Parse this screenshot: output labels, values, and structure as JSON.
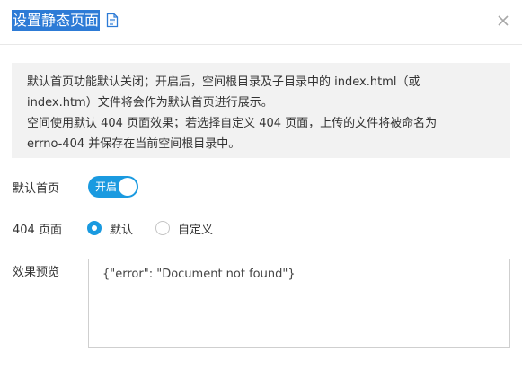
{
  "dialog": {
    "title": "设置静态页面",
    "doc_icon": "document-icon",
    "close_icon": "close-icon",
    "accent_color": "#1a9ae0",
    "title_highlight_color": "#2d7bd6"
  },
  "notice": {
    "lines": [
      "默认首页功能默认关闭；开启后，空间根目录及子目录中的 index.html（或",
      "index.htm）文件将会作为默认首页进行展示。",
      "空间使用默认 404 页面效果；若选择自定义 404 页面，上传的文件将被命名为",
      "errno-404 并保存在当前空间根目录中。"
    ]
  },
  "default_index": {
    "label": "默认首页",
    "switch_text": "开启",
    "enabled": true
  },
  "page_404": {
    "label": "404 页面",
    "options": [
      {
        "label": "默认",
        "checked": true
      },
      {
        "label": "自定义",
        "checked": false
      }
    ]
  },
  "preview": {
    "label": "效果预览",
    "content": "{\"error\": \"Document not found\"}"
  }
}
